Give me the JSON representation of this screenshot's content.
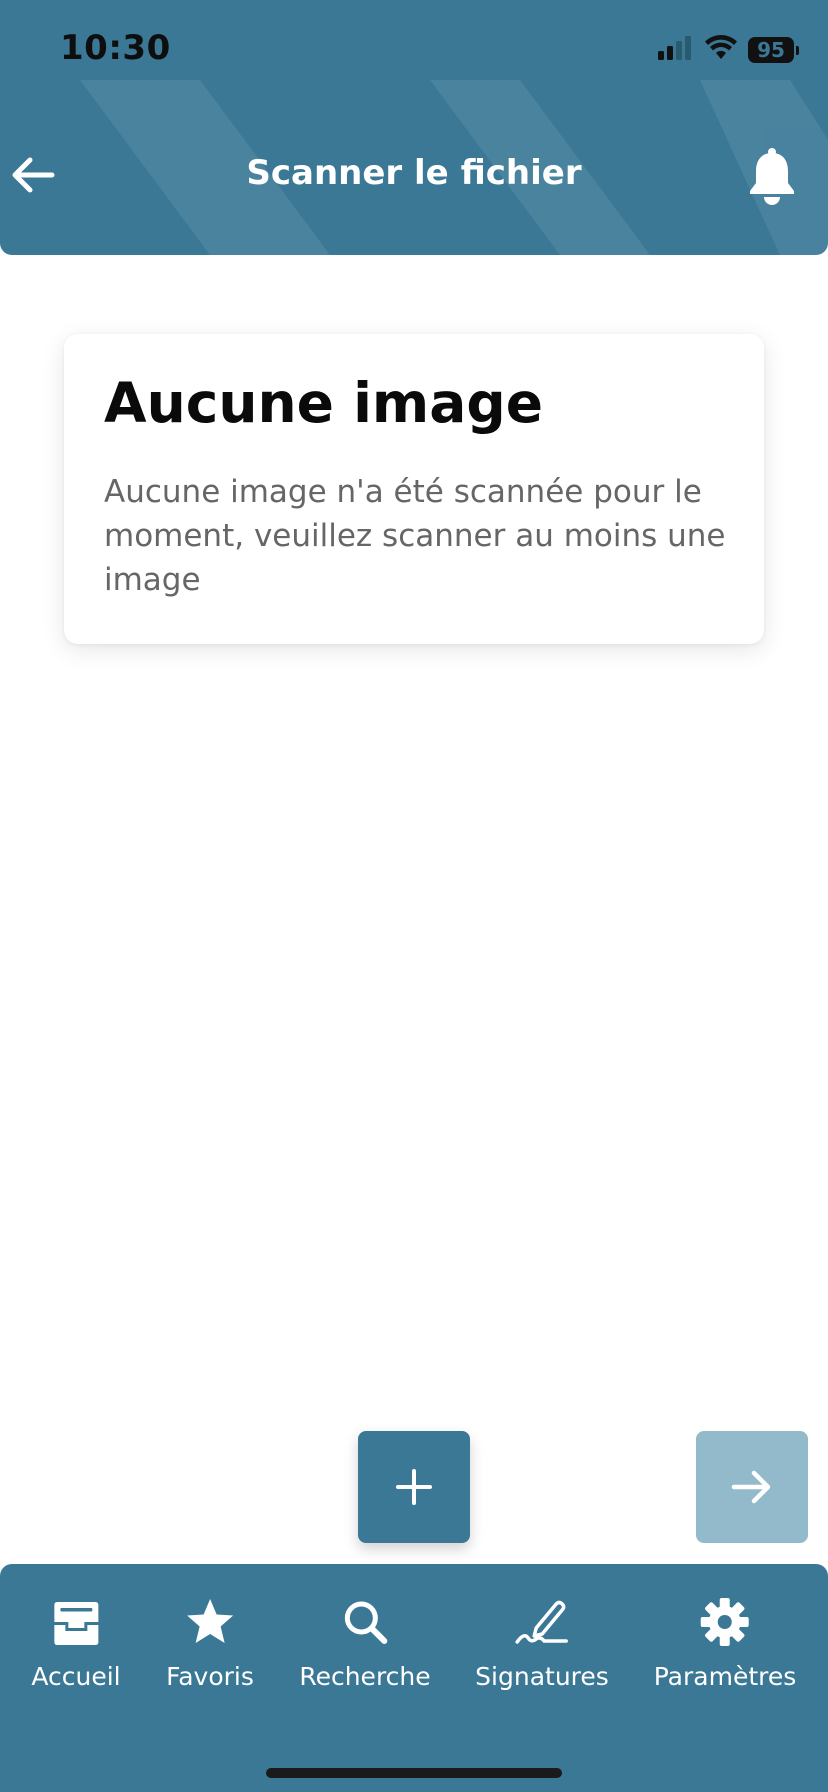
{
  "status_bar": {
    "time": "10:30",
    "battery": "95",
    "signal_icon": "cellular-signal-icon",
    "wifi_icon": "wifi-icon"
  },
  "header": {
    "title": "Scanner le fichier",
    "back_icon": "arrow-left-icon",
    "bell_icon": "bell-icon"
  },
  "card": {
    "title": "Aucune image",
    "text": "Aucune image n'a été scannée pour le moment, veuillez scanner au moins une image"
  },
  "actions": {
    "add_icon": "plus-icon",
    "next_icon": "arrow-right-icon"
  },
  "tabs": [
    {
      "label": "Accueil",
      "icon": "inbox-icon"
    },
    {
      "label": "Favoris",
      "icon": "star-icon"
    },
    {
      "label": "Recherche",
      "icon": "search-icon"
    },
    {
      "label": "Signatures",
      "icon": "signature-icon"
    },
    {
      "label": "Paramètres",
      "icon": "gear-icon"
    }
  ],
  "colors": {
    "primary": "#3a7896",
    "primary_disabled": "#93bacb",
    "background": "#ffffff",
    "card_text": "#666666"
  }
}
